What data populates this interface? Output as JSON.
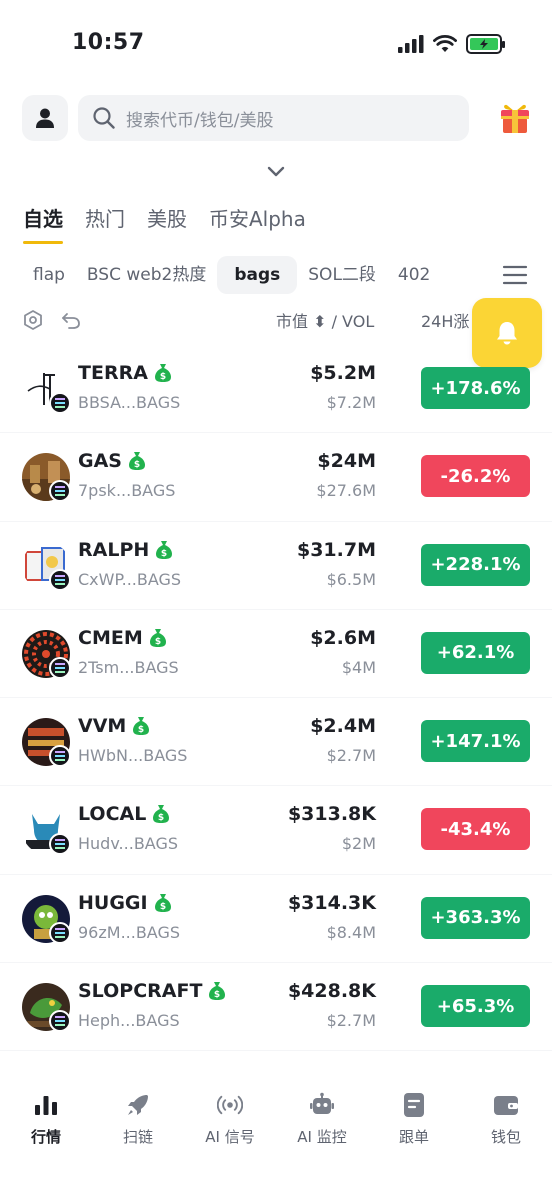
{
  "status_bar": {
    "time": "10:57"
  },
  "search": {
    "placeholder": "搜索代币/钱包/美股"
  },
  "main_tabs": [
    {
      "label": "自选",
      "active": true
    },
    {
      "label": "热门",
      "active": false
    },
    {
      "label": "美股",
      "active": false
    },
    {
      "label": "币安Alpha",
      "active": false
    }
  ],
  "sub_tabs": [
    {
      "label": "flap",
      "active": false
    },
    {
      "label": "BSC web2热度",
      "active": false
    },
    {
      "label": "bags",
      "active": true
    },
    {
      "label": "SOL二段",
      "active": false
    },
    {
      "label": "402",
      "active": false
    }
  ],
  "columns": {
    "market_cap": "市值 ⬍ / VOL",
    "change": "24H涨"
  },
  "colors": {
    "up": "#1aab6a",
    "down": "#f0465c",
    "accent": "#f0b90b",
    "bell": "#fbd535",
    "badge_money": "#21b24d"
  },
  "tokens": [
    {
      "symbol": "TERRA",
      "address": "BBSA...BAGS",
      "market_cap": "$5.2M",
      "volume": "$7.2M",
      "change": "+178.6%",
      "direction": "up"
    },
    {
      "symbol": "GAS",
      "address": "7psk...BAGS",
      "market_cap": "$24M",
      "volume": "$27.6M",
      "change": "-26.2%",
      "direction": "down"
    },
    {
      "symbol": "RALPH",
      "address": "CxWP...BAGS",
      "market_cap": "$31.7M",
      "volume": "$6.5M",
      "change": "+228.1%",
      "direction": "up"
    },
    {
      "symbol": "CMEM",
      "address": "2Tsm...BAGS",
      "market_cap": "$2.6M",
      "volume": "$4M",
      "change": "+62.1%",
      "direction": "up"
    },
    {
      "symbol": "VVM",
      "address": "HWbN...BAGS",
      "market_cap": "$2.4M",
      "volume": "$2.7M",
      "change": "+147.1%",
      "direction": "up"
    },
    {
      "symbol": "LOCAL",
      "address": "Hudv...BAGS",
      "market_cap": "$313.8K",
      "volume": "$2M",
      "change": "-43.4%",
      "direction": "down"
    },
    {
      "symbol": "HUGGI",
      "address": "96zM...BAGS",
      "market_cap": "$314.3K",
      "volume": "$8.4M",
      "change": "+363.3%",
      "direction": "up"
    },
    {
      "symbol": "SLOPCRAFT",
      "address": "Heph...BAGS",
      "market_cap": "$428.8K",
      "volume": "$2.7M",
      "change": "+65.3%",
      "direction": "up"
    }
  ],
  "bottom_nav": [
    {
      "label": "行情",
      "icon": "bar-chart-icon",
      "active": true
    },
    {
      "label": "扫链",
      "icon": "rocket-icon",
      "active": false
    },
    {
      "label": "AI 信号",
      "icon": "broadcast-icon",
      "active": false
    },
    {
      "label": "AI 监控",
      "icon": "robot-icon",
      "active": false
    },
    {
      "label": "跟单",
      "icon": "document-icon",
      "active": false
    },
    {
      "label": "钱包",
      "icon": "wallet-icon",
      "active": false
    }
  ]
}
